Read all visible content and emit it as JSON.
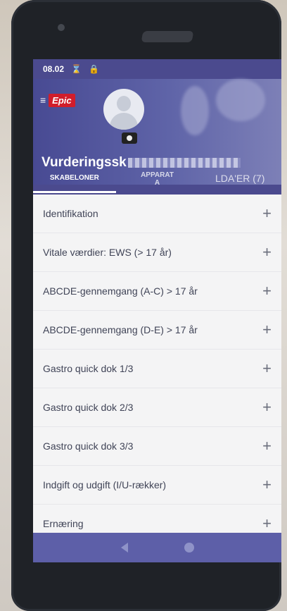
{
  "status_bar": {
    "time": "08.02"
  },
  "header": {
    "logo_text": "Epic",
    "patient_title": "Vurderingssk"
  },
  "tabs": [
    {
      "label": "SKABELONER"
    },
    {
      "label": "APPARAT\nA"
    },
    {
      "label": "LDA'ER (7)"
    }
  ],
  "list": {
    "items": [
      {
        "label": "Identifikation"
      },
      {
        "label": "Vitale værdier: EWS (> 17 år)"
      },
      {
        "label": "ABCDE-gennemgang (A-C) > 17 år"
      },
      {
        "label": "ABCDE-gennemgang (D-E) > 17 år"
      },
      {
        "label": "Gastro quick dok 1/3"
      },
      {
        "label": "Gastro quick dok 2/3"
      },
      {
        "label": "Gastro quick dok 3/3"
      },
      {
        "label": "Indgift og udgift (I/U-rækker)"
      },
      {
        "label": "Ernæring"
      }
    ],
    "add_symbol": "+"
  },
  "colors": {
    "header": "#4b4a8e",
    "epic_red": "#d11d2b",
    "list_bg": "#f4f4f5",
    "text": "#404457"
  }
}
